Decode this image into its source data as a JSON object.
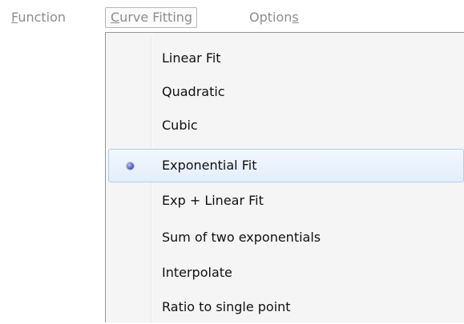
{
  "menubar": {
    "items": [
      {
        "accel": "F",
        "rest": "unction"
      },
      {
        "accel": "C",
        "rest": "urve Fitting"
      },
      {
        "pre": "Option",
        "accel": "s"
      }
    ]
  },
  "dropdown": {
    "items": [
      {
        "label": "Linear Fit"
      },
      {
        "label": "Quadratic"
      },
      {
        "label": "Cubic"
      },
      {
        "label": "Exponential Fit",
        "selected": true
      },
      {
        "label": "Exp + Linear Fit"
      },
      {
        "label": "Sum of two exponentials"
      },
      {
        "label": "Interpolate"
      },
      {
        "label": "Ratio to single point"
      }
    ]
  },
  "colors": {
    "disabled_text": "#8d8d8d",
    "menu_background": "#f5f5f5",
    "highlight_border": "#b3cdef",
    "radio_dot": "#5a64c8"
  }
}
